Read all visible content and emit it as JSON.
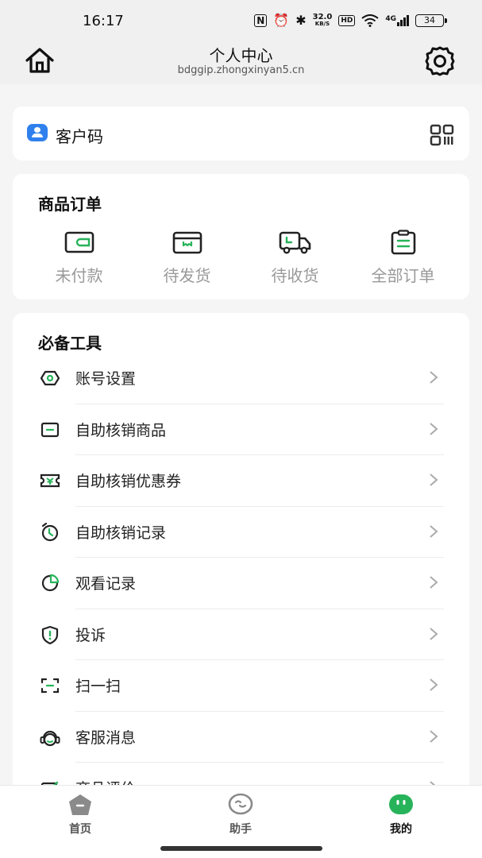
{
  "status_bar": {
    "time": "16:17",
    "nfc": "N",
    "alarm": "⏰",
    "bluetooth": "✱",
    "net_speed_value": "32.0",
    "net_speed_unit": "KB/S",
    "hd": "HD",
    "network_type": "4G",
    "battery": "34"
  },
  "header": {
    "title": "个人中心",
    "subtitle": "bdggip.zhongxinyan5.cn",
    "home_icon": "home-icon",
    "settings_icon": "gear-icon"
  },
  "customer_code": {
    "label": "客户码",
    "icon": "id-card-icon",
    "action_icon": "qr-code-icon"
  },
  "orders": {
    "title": "商品订单",
    "items": [
      {
        "label": "未付款",
        "icon": "wallet-icon"
      },
      {
        "label": "待发货",
        "icon": "package-icon"
      },
      {
        "label": "待收货",
        "icon": "truck-icon"
      },
      {
        "label": "全部订单",
        "icon": "clipboard-icon"
      }
    ]
  },
  "tools": {
    "title": "必备工具",
    "items": [
      {
        "label": "账号设置",
        "icon": "account-settings-icon"
      },
      {
        "label": "自助核销商品",
        "icon": "tray-icon"
      },
      {
        "label": "自助核销优惠券",
        "icon": "coupon-icon"
      },
      {
        "label": "自助核销记录",
        "icon": "clock-icon"
      },
      {
        "label": "观看记录",
        "icon": "pie-chart-icon"
      },
      {
        "label": "投诉",
        "icon": "warning-shield-icon"
      },
      {
        "label": "扫一扫",
        "icon": "scan-icon"
      },
      {
        "label": "客服消息",
        "icon": "headset-icon"
      },
      {
        "label": "商品评价",
        "icon": "review-icon"
      }
    ]
  },
  "tabbar": {
    "items": [
      {
        "label": "首页",
        "icon": "home-tab-icon"
      },
      {
        "label": "助手",
        "icon": "assistant-tab-icon"
      },
      {
        "label": "我的",
        "icon": "profile-tab-icon"
      }
    ],
    "active_color": "#27b35a",
    "inactive_color": "#8a8a8a"
  },
  "colors": {
    "accent_green": "#27b35a",
    "code_blue": "#2f80ed"
  }
}
